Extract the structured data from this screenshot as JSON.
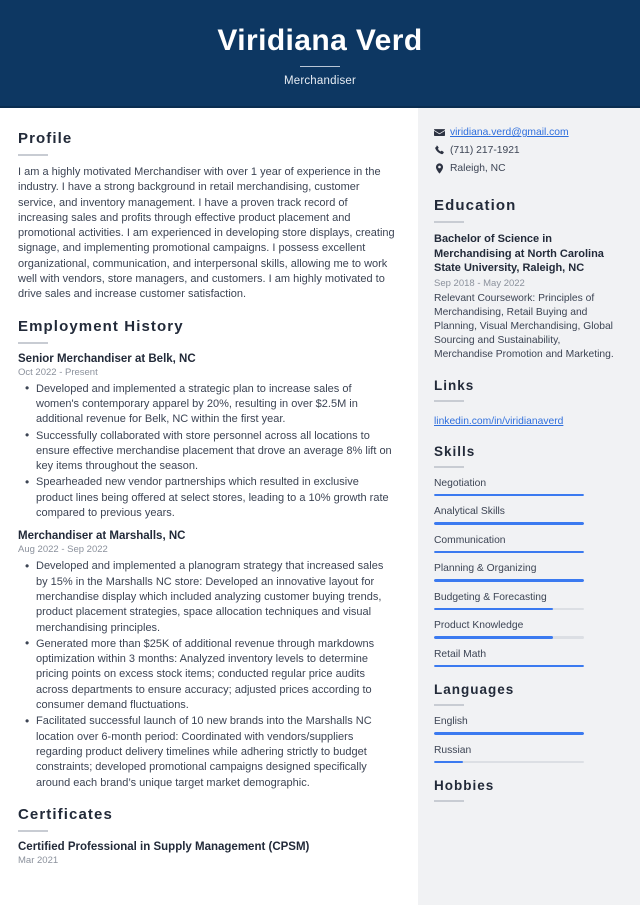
{
  "theme": {
    "header_bg": "#0d3762",
    "sidebar_bg": "#f1f2f4",
    "accent_bar": "#3b7af0",
    "link_color": "#2f6fdd",
    "text_color": "#3c4454",
    "muted_color": "#8b919c"
  },
  "header": {
    "name": "Viridiana Verd",
    "job_title": "Merchandiser"
  },
  "profile": {
    "heading": "Profile",
    "text": "I am a highly motivated Merchandiser with over 1 year of experience in the industry. I have a strong background in retail merchandising, customer service, and inventory management. I have a proven track record of increasing sales and profits through effective product placement and promotional activities. I am experienced in developing store displays, creating signage, and implementing promotional campaigns. I possess excellent organizational, communication, and interpersonal skills, allowing me to work well with vendors, store managers, and customers. I am highly motivated to drive sales and increase customer satisfaction."
  },
  "employment": {
    "heading": "Employment History",
    "jobs": [
      {
        "title": "Senior Merchandiser at Belk, NC",
        "dates": "Oct 2022 - Present",
        "bullets": [
          "Developed and implemented a strategic plan to increase sales of women's contemporary apparel by 20%, resulting in over $2.5M in additional revenue for Belk, NC within the first year.",
          "Successfully collaborated with store personnel across all locations to ensure effective merchandise placement that drove an average 8% lift on key items throughout the season.",
          "Spearheaded new vendor partnerships which resulted in exclusive product lines being offered at select stores, leading to a 10% growth rate compared to previous years."
        ]
      },
      {
        "title": "Merchandiser at Marshalls, NC",
        "dates": "Aug 2022 - Sep 2022",
        "bullets": [
          "Developed and implemented a planogram strategy that increased sales by 15% in the Marshalls NC store: Developed an innovative layout for merchandise display which included analyzing customer buying trends, product placement strategies, space allocation techniques and visual merchandising principles.",
          "Generated more than $25K of additional revenue through markdowns optimization within 3 months: Analyzed inventory levels to determine pricing points on excess stock items; conducted regular price audits across departments to ensure accuracy; adjusted prices according to consumer demand fluctuations.",
          "Facilitated successful launch of 10 new brands into the Marshalls NC location over 6-month period: Coordinated with vendors/suppliers regarding product delivery timelines while adhering strictly to budget constraints; developed promotional campaigns designed specifically around each brand’s unique target market demographic."
        ]
      }
    ]
  },
  "certificates": {
    "heading": "Certificates",
    "items": [
      {
        "title": "Certified Professional in Supply Management (CPSM)",
        "date": "Mar 2021"
      }
    ]
  },
  "contact": {
    "email": {
      "icon": "envelope-icon",
      "value": "viridiana.verd@gmail.com"
    },
    "phone": {
      "icon": "phone-icon",
      "value": "(711) 217-1921"
    },
    "location": {
      "icon": "map-pin-icon",
      "value": "Raleigh, NC"
    }
  },
  "education": {
    "heading": "Education",
    "items": [
      {
        "degree": "Bachelor of Science in Merchandising at North Carolina State University, Raleigh, NC",
        "dates": "Sep 2018 - May 2022",
        "description": "Relevant Coursework: Principles of Merchandising, Retail Buying and Planning, Visual Merchandising, Global Sourcing and Sustainability, Merchandise Promotion and Marketing."
      }
    ]
  },
  "links": {
    "heading": "Links",
    "items": [
      {
        "label": "linkedin.com/in/viridianaverd"
      }
    ]
  },
  "skills": {
    "heading": "Skills",
    "items": [
      {
        "label": "Negotiation",
        "level": 100
      },
      {
        "label": "Analytical Skills",
        "level": 100
      },
      {
        "label": "Communication",
        "level": 100
      },
      {
        "label": "Planning & Organizing",
        "level": 100
      },
      {
        "label": "Budgeting & Forecasting",
        "level": 79
      },
      {
        "label": "Product Knowledge",
        "level": 79
      },
      {
        "label": "Retail Math",
        "level": 100
      }
    ]
  },
  "languages": {
    "heading": "Languages",
    "items": [
      {
        "label": "English",
        "level": 100
      },
      {
        "label": "Russian",
        "level": 19
      }
    ]
  },
  "hobbies": {
    "heading": "Hobbies"
  }
}
